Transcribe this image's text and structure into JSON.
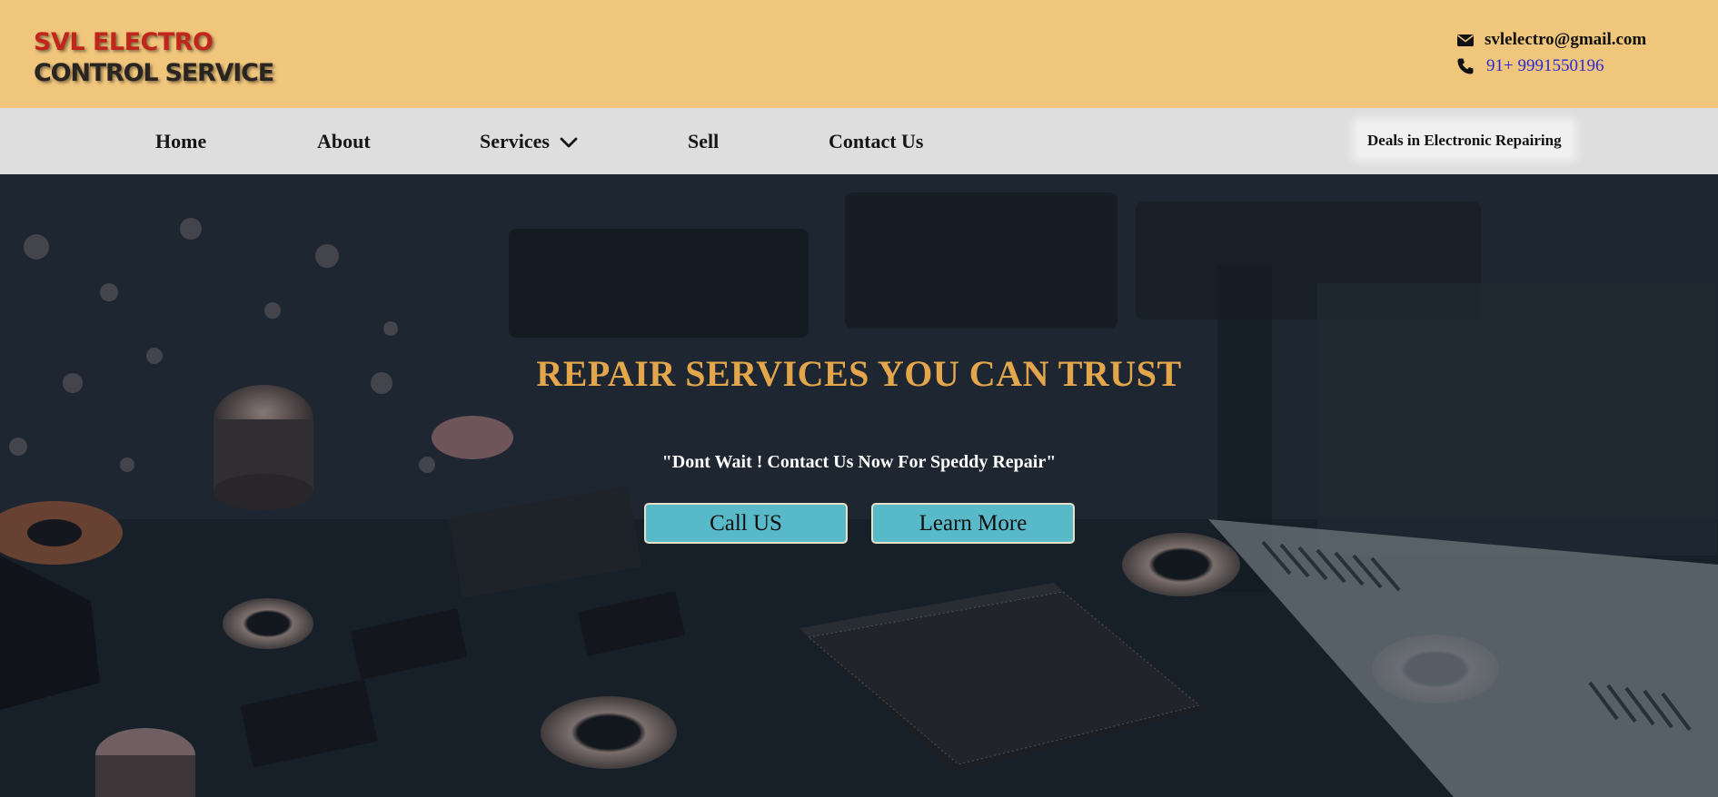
{
  "brand": {
    "line1": "SVL ELECTRO",
    "line2": "CONTROL SERVICE"
  },
  "contact": {
    "email": "svlelectro@gmail.com",
    "phone": "91+ 9991550196",
    "email_icon": "envelope-icon",
    "phone_icon": "phone-icon"
  },
  "nav": {
    "items": [
      {
        "label": "Home"
      },
      {
        "label": "About"
      },
      {
        "label": "Services",
        "icon": "chevron-down-icon"
      },
      {
        "label": "Sell"
      },
      {
        "label": "Contact Us"
      }
    ],
    "tagline": "Deals in Electronic Repairing"
  },
  "hero": {
    "title": "REPAIR SERVICES YOU CAN TRUST",
    "subtitle": "\"Dont Wait ! Contact Us Now For Speddy Repair\"",
    "buttons": {
      "call": "Call US",
      "learn_more": "Learn More"
    }
  },
  "colors": {
    "header_bg": "#f0c67c",
    "nav_bg": "#dedede",
    "brand_red": "#c0261b",
    "hero_title": "#e4a64b",
    "button_bg": "#58b9c9",
    "phone_link": "#2a27d6"
  }
}
